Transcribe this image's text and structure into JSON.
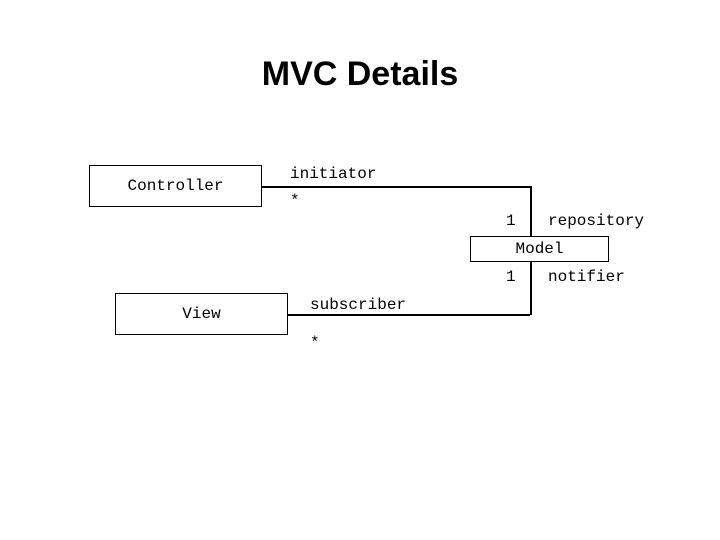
{
  "title": "MVC Details",
  "boxes": {
    "controller": "Controller",
    "view": "View",
    "model": "Model"
  },
  "labels": {
    "initiator": "initiator",
    "repository": "repository",
    "subscriber": "subscriber",
    "notifier": "notifier",
    "star1": "*",
    "one1": "1",
    "star2": "*",
    "one2": "1"
  }
}
